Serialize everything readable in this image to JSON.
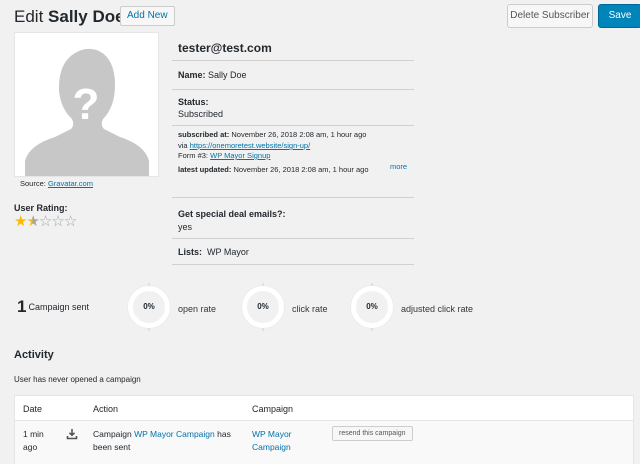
{
  "header": {
    "title_prefix": "Edit",
    "subscriber_name": "Sally Doe",
    "add_new_label": "Add New",
    "delete_label": "Delete Subscriber",
    "save_label": "Save"
  },
  "avatar": {
    "source_label": "Source:",
    "source_link": "Gravatar.com",
    "icon": "unknown-person-avatar"
  },
  "rating": {
    "label": "User Rating:",
    "value": 1.5,
    "max": 5
  },
  "profile": {
    "email": "tester@test.com",
    "name_label": "Name:",
    "name": "Sally Doe",
    "status_label": "Status:",
    "status": "Subscribed",
    "subscribed_at_label": "subscribed at:",
    "subscribed_at": "November 26, 2018 2:08 am, 1 hour ago",
    "via_label": "via",
    "via_link": "https://onemoretest.website/sign-up/",
    "form_label": "Form #3:",
    "form_link": "WP Mayor Signup",
    "updated_label": "latest updated:",
    "updated": "November 26, 2018 2:08 am, 1 hour ago",
    "more_label": "more",
    "deal_question": "Get special deal emails?:",
    "deal_answer": "yes",
    "lists_label": "Lists:",
    "lists_value": "WP Mayor"
  },
  "stats": {
    "campaigns_count": "1",
    "campaigns_label": "Campaign sent",
    "open_rate_value": "0%",
    "open_rate_label": "open rate",
    "click_rate_value": "0%",
    "click_rate_label": "click rate",
    "adjusted_value": "0%",
    "adjusted_label": "adjusted click rate"
  },
  "activity": {
    "heading": "Activity",
    "never_opened": "User has never opened a campaign",
    "columns": [
      "Date",
      "Action",
      "Campaign"
    ],
    "rows": [
      {
        "date": "1 min ago",
        "action_prefix": "Campaign",
        "action_link": "WP Mayor Campaign",
        "action_suffix": "has been sent",
        "campaign": "WP Mayor Campaign",
        "resend_label": "resend this campaign",
        "icon": "download-icon"
      }
    ]
  },
  "colors": {
    "primary": "#0085ba",
    "link": "#0073aa",
    "star": "#ffb900"
  }
}
